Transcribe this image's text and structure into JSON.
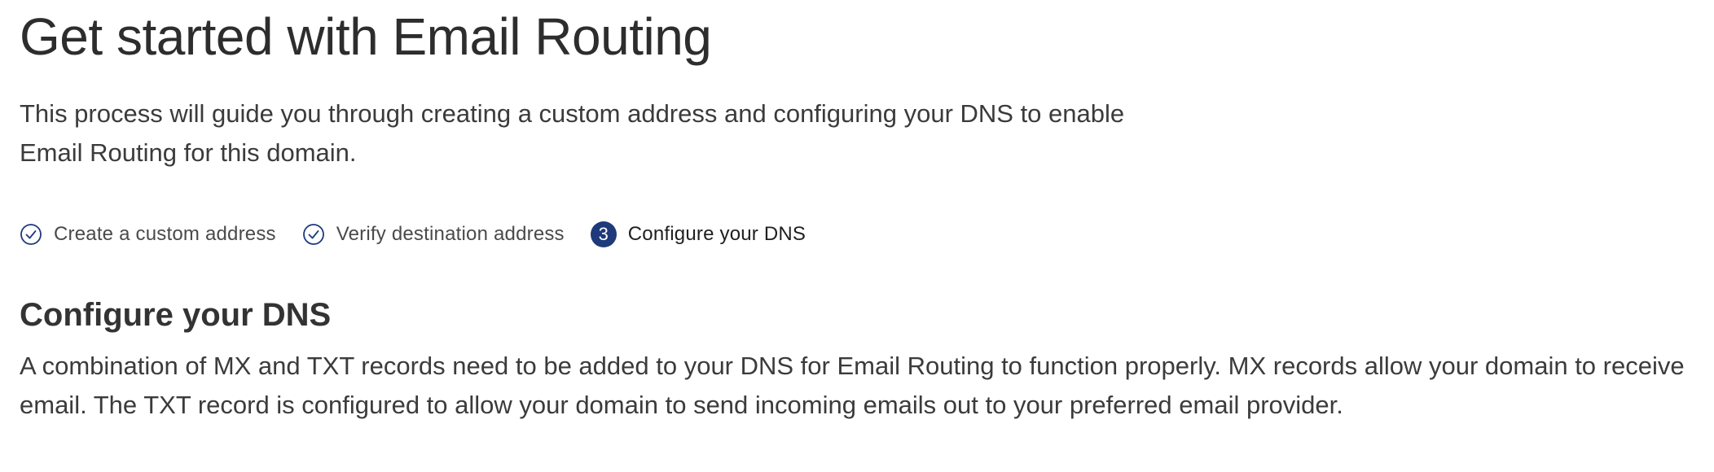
{
  "page": {
    "title": "Get started with Email Routing",
    "intro": "This process will guide you through creating a custom address and configuring your DNS to enable Email Routing for this domain."
  },
  "steps": [
    {
      "label": "Create a custom address",
      "status": "complete",
      "icon": "check-circle-icon"
    },
    {
      "label": "Verify destination address",
      "status": "complete",
      "icon": "check-circle-icon"
    },
    {
      "label": "Configure your DNS",
      "status": "current",
      "number": "3"
    }
  ],
  "section": {
    "title": "Configure your DNS",
    "body": "A combination of MX and TXT records need to be added to your DNS for Email Routing to function properly. MX records allow your domain to receive email. The TXT record is configured to allow your domain to send incoming emails out to your preferred email provider."
  },
  "colors": {
    "accent": "#1e3a7b",
    "text": "#313131"
  }
}
